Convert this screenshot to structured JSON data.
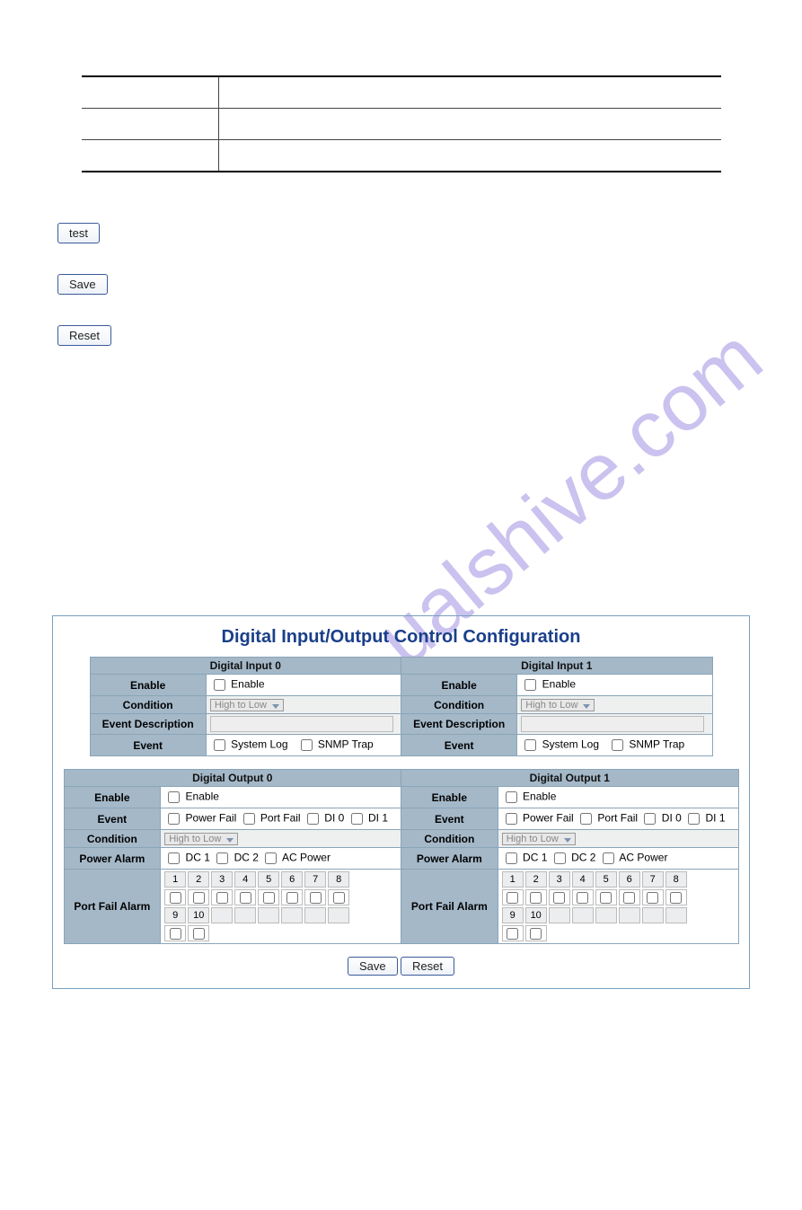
{
  "watermark": "ualshive.com",
  "buttons": {
    "test": "test",
    "save": "Save",
    "reset": "Reset"
  },
  "panel": {
    "title": "Digital Input/Output Control Configuration",
    "di": [
      {
        "header": "Digital Input 0",
        "rows": {
          "enable_label": "Enable",
          "enable_option": "Enable",
          "condition_label": "Condition",
          "condition_value": "High to Low",
          "event_desc_label": "Event Description",
          "event_label": "Event",
          "event_opt1": "System Log",
          "event_opt2": "SNMP Trap"
        }
      },
      {
        "header": "Digital Input 1",
        "rows": {
          "enable_label": "Enable",
          "enable_option": "Enable",
          "condition_label": "Condition",
          "condition_value": "High to Low",
          "event_desc_label": "Event Description",
          "event_label": "Event",
          "event_opt1": "System Log",
          "event_opt2": "SNMP Trap"
        }
      }
    ],
    "do": [
      {
        "header": "Digital Output 0",
        "rows": {
          "enable_label": "Enable",
          "enable_option": "Enable",
          "event_label": "Event",
          "ev_power": "Power Fail",
          "ev_port": "Port Fail",
          "ev_di0": "DI 0",
          "ev_di1": "DI 1",
          "condition_label": "Condition",
          "condition_value": "High to Low",
          "power_alarm_label": "Power Alarm",
          "pa_dc1": "DC 1",
          "pa_dc2": "DC 2",
          "pa_ac": "AC Power",
          "port_fail_label": "Port Fail Alarm",
          "ports_row1": [
            "1",
            "2",
            "3",
            "4",
            "5",
            "6",
            "7",
            "8"
          ],
          "ports_row2": [
            "9",
            "10"
          ]
        }
      },
      {
        "header": "Digital Output 1",
        "rows": {
          "enable_label": "Enable",
          "enable_option": "Enable",
          "event_label": "Event",
          "ev_power": "Power Fail",
          "ev_port": "Port Fail",
          "ev_di0": "DI 0",
          "ev_di1": "DI 1",
          "condition_label": "Condition",
          "condition_value": "High to Low",
          "power_alarm_label": "Power Alarm",
          "pa_dc1": "DC 1",
          "pa_dc2": "DC 2",
          "pa_ac": "AC Power",
          "port_fail_label": "Port Fail Alarm",
          "ports_row1": [
            "1",
            "2",
            "3",
            "4",
            "5",
            "6",
            "7",
            "8"
          ],
          "ports_row2": [
            "9",
            "10"
          ]
        }
      }
    ],
    "bottom": {
      "save": "Save",
      "reset": "Reset"
    }
  }
}
